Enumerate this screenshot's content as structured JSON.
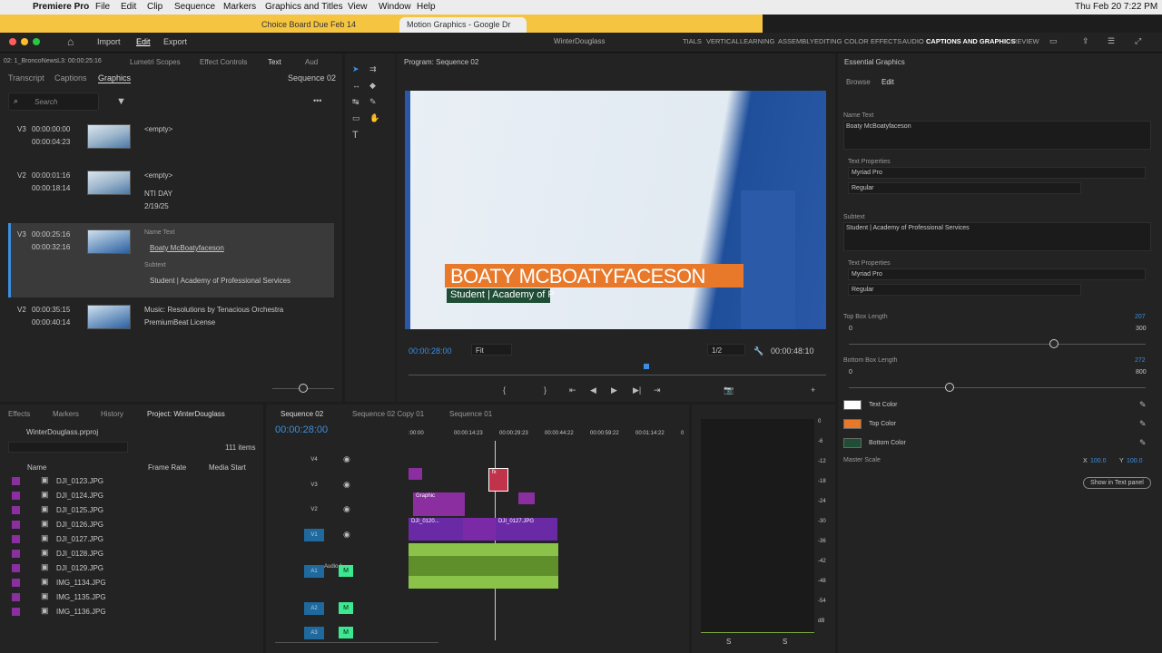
{
  "mac": {
    "apple": "",
    "app": "Premiere Pro",
    "menus": [
      "File",
      "Edit",
      "Clip",
      "Sequence",
      "Markers",
      "Graphics and Titles",
      "View",
      "Window",
      "Help"
    ],
    "clock": "Thu Feb 20  7:22 PM"
  },
  "browser": {
    "tabs": [
      "Choice Board Due Feb 14",
      "Motion Graphics - Google Dr"
    ]
  },
  "app": {
    "nav": [
      "Import",
      "Edit",
      "Export"
    ],
    "project": "WinterDouglass",
    "workspaces": [
      "TIALS",
      "VERTICAL",
      "LEARNING",
      "ASSEMBLY",
      "EDITING",
      "COLOR",
      "EFFECTS",
      "AUDIO",
      "CAPTIONS AND GRAPHICS",
      "REVIEW"
    ]
  },
  "source": {
    "header": "02: 1_BroncoNewsL3: 00:00:25:16",
    "tabs": [
      "Lumetri Scopes",
      "Effect Controls",
      "Text",
      "Aud"
    ],
    "subtabs": [
      "Transcript",
      "Captions",
      "Graphics"
    ],
    "sequence": "Sequence 02",
    "search_placeholder": "Search",
    "items": [
      {
        "track": "V3",
        "in": "00:00:00:00",
        "out": "00:00:04:23",
        "lines": [
          "<empty>"
        ]
      },
      {
        "track": "V2",
        "in": "00:00:01:16",
        "out": "00:00:18:14",
        "lines": [
          "<empty>",
          "NTI DAY",
          "2/19/25"
        ]
      },
      {
        "track": "V3",
        "in": "00:00:25:16",
        "out": "00:00:32:16",
        "label1": "Name Text",
        "value1": "Boaty McBoatyfaceson",
        "label2": "Subtext",
        "value2": "Student | Academy of Professional Services"
      },
      {
        "track": "V2",
        "in": "00:00:35:15",
        "out": "00:00:40:14",
        "lines": [
          "Music: Resolutions by Tenacious Orchestra",
          "PremiumBeat License"
        ]
      }
    ]
  },
  "program": {
    "title": "Program: Sequence 02",
    "lower_third_name": "BOATY MCBOATYFACESON",
    "lower_third_sub": "Student | Academy of P",
    "timecode": "00:00:28:00",
    "fit": "Fit",
    "res": "1/2",
    "duration": "00:00:48:10"
  },
  "project": {
    "tabs": [
      "Effects",
      "Markers",
      "History",
      "Project: WinterDouglass"
    ],
    "file": "WinterDouglass.prproj",
    "count": "111 items",
    "cols": [
      "Name",
      "Frame Rate",
      "Media Start"
    ],
    "files": [
      "DJI_0123.JPG",
      "DJI_0124.JPG",
      "DJI_0125.JPG",
      "DJI_0126.JPG",
      "DJI_0127.JPG",
      "DJI_0128.JPG",
      "DJI_0129.JPG",
      "IMG_1134.JPG",
      "IMG_1135.JPG",
      "IMG_1136.JPG"
    ]
  },
  "timeline": {
    "tabs": [
      "Sequence 02",
      "Sequence 02 Copy 01",
      "Sequence 01"
    ],
    "timecode": "00:00:28:00",
    "ruler": [
      ":00:00",
      "00:00:14:23",
      "00:00:29:23",
      "00:00:44:22",
      "00:00:59:22",
      "00:01:14:22",
      "0"
    ],
    "tracks": [
      "V4",
      "V3",
      "V2",
      "V1",
      "A1",
      "A2",
      "A3"
    ],
    "audio_label": "Audio 1",
    "clips": {
      "graphic": "Graphic",
      "dji1": "DJI_0120...",
      "dji2": "DJI_0127.JPG",
      "fx": "fx"
    }
  },
  "meter": {
    "scale": [
      "0",
      "-6",
      "-12",
      "-18",
      "-24",
      "-30",
      "-36",
      "-42",
      "-48",
      "-54",
      "dB"
    ],
    "s": "S"
  },
  "eg": {
    "title": "Essential Graphics",
    "tabs": [
      "Browse",
      "Edit"
    ],
    "name_label": "Name Text",
    "name_value": "Boaty McBoatyfaceson",
    "text_props": "Text Properties",
    "font": "Myriad Pro",
    "style": "Regular",
    "sub_label": "Subtext",
    "sub_value": "Student | Academy of Professional Services",
    "top_box": {
      "label": "Top Box Length",
      "value": "207",
      "min": "0",
      "max": "300",
      "frac": 0.69
    },
    "bottom_box": {
      "label": "Bottom Box Length",
      "value": "272",
      "min": "0",
      "max": "800",
      "frac": 0.34
    },
    "colors": [
      {
        "label": "Text Color",
        "hex": "#ffffff"
      },
      {
        "label": "Top Color",
        "hex": "#e8792a"
      },
      {
        "label": "Bottom Color",
        "hex": "#1f4d35"
      }
    ],
    "master": {
      "label": "Master Scale",
      "x_label": "X",
      "x": "100.0",
      "y_label": "Y",
      "y": "100.0"
    },
    "show_btn": "Show in Text panel"
  }
}
